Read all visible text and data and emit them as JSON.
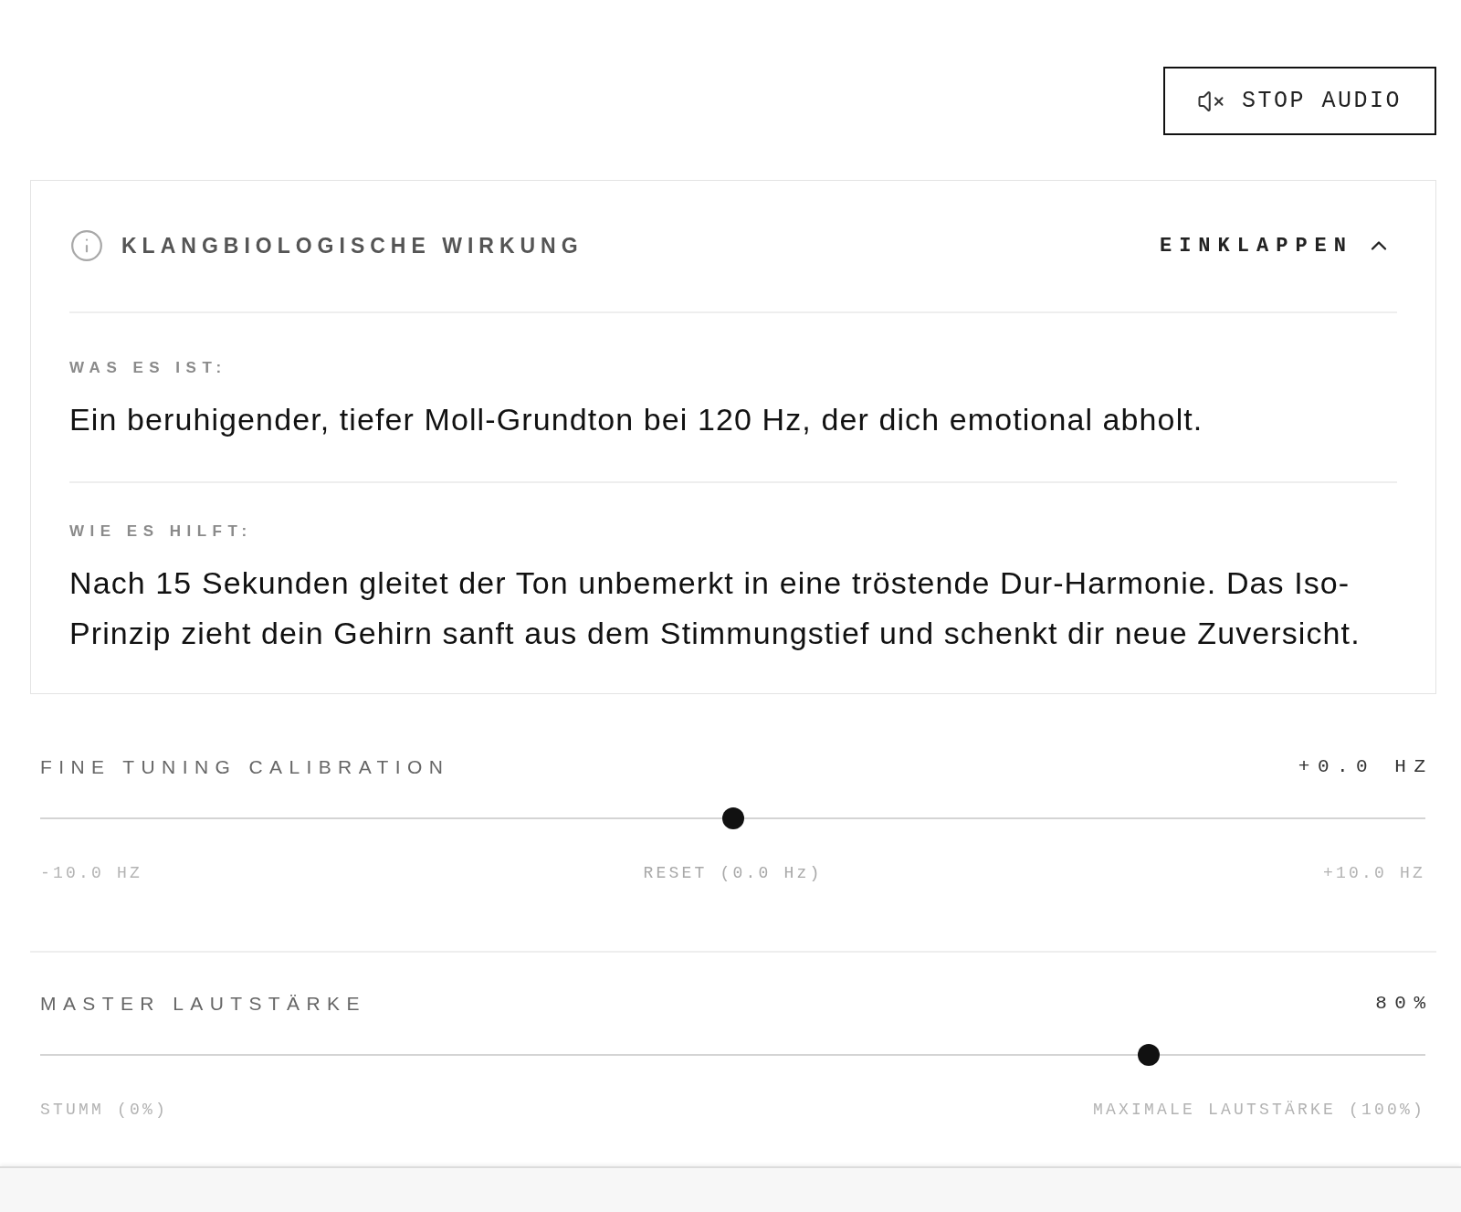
{
  "header": {
    "stop_button": {
      "label": "STOP AUDIO"
    }
  },
  "info_panel": {
    "title": "KLANGBIOLOGISCHE WIRKUNG",
    "toggle": {
      "label": "EINKLAPPEN",
      "expanded": true
    },
    "sections": [
      {
        "label": "WAS ES IST:",
        "text": "Ein beruhigender, tiefer Moll-Grundton bei 120 Hz, der dich emotional abholt."
      },
      {
        "label": "WIE ES HILFT:",
        "text": "Nach 15 Sekunden gleitet der Ton unbemerkt in eine tröstende Dur-Harmonie. Das Iso-Prinzip zieht dein Gehirn sanft aus dem Stimmungstief und schenkt dir neue Zuversicht."
      }
    ]
  },
  "sliders": [
    {
      "label": "FINE TUNING CALIBRATION",
      "reading": "+0.0 HZ",
      "level": 0.5,
      "min_label": "-10.0 HZ",
      "reset_button": "RESET (0.0 Hz)",
      "max_label": "+10.0 HZ"
    },
    {
      "label": "MASTER LAUTSTÄRKE",
      "reading": "80%",
      "level": 0.8,
      "min_label": "STUMM (0%)",
      "max_label": "MAXIMALE LAUTSTÄRKE (100%)"
    }
  ]
}
